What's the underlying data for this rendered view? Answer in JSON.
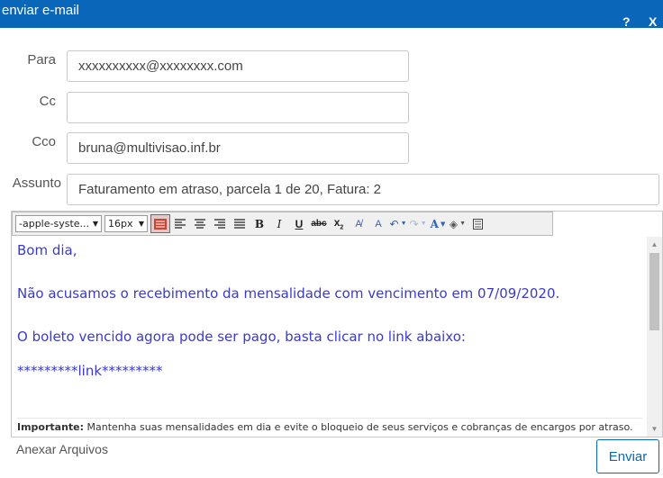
{
  "window": {
    "title": "enviar e-mail",
    "help_label": "?",
    "close_label": "X"
  },
  "form": {
    "to_label": "Para",
    "to_value": "xxxxxxxxxx@xxxxxxxx.com",
    "cc_label": "Cc",
    "cc_value": "",
    "bcc_label": "Cco",
    "bcc_value": "bruna@multivisao.inf.br",
    "subject_label": "Assunto",
    "subject_value": "Faturamento em atraso, parcela 1 de 20, Fatura: 2"
  },
  "toolbar": {
    "font_family": "-apple-syste...",
    "font_size": "16px",
    "buttons": [
      "html",
      "align-left",
      "align-center",
      "align-right",
      "justify",
      "bold",
      "italic",
      "underline",
      "strikethrough",
      "subscript",
      "spell",
      "spell-all",
      "undo",
      "redo",
      "font-color",
      "background-color",
      "source"
    ]
  },
  "editor": {
    "lines": [
      "Bom dia,",
      "Não acusamos o recebimento da mensalidade com vencimento em 07/09/2020.",
      "O boleto vencido agora pode ser pago, basta clicar no link abaixo:",
      " *********link*********"
    ],
    "note_bold": "Importante:",
    "note_text": " Mantenha suas mensalidades em dia e evite o bloqueio de seus serviços e cobranças de encargos por atraso."
  },
  "actions": {
    "attach_label": "Anexar Arquivos",
    "send_label": "Enviar"
  },
  "colors": {
    "titlebar": "#0a66b8",
    "editor_text": "#3a3acd",
    "send_border": "#0a66b8"
  }
}
